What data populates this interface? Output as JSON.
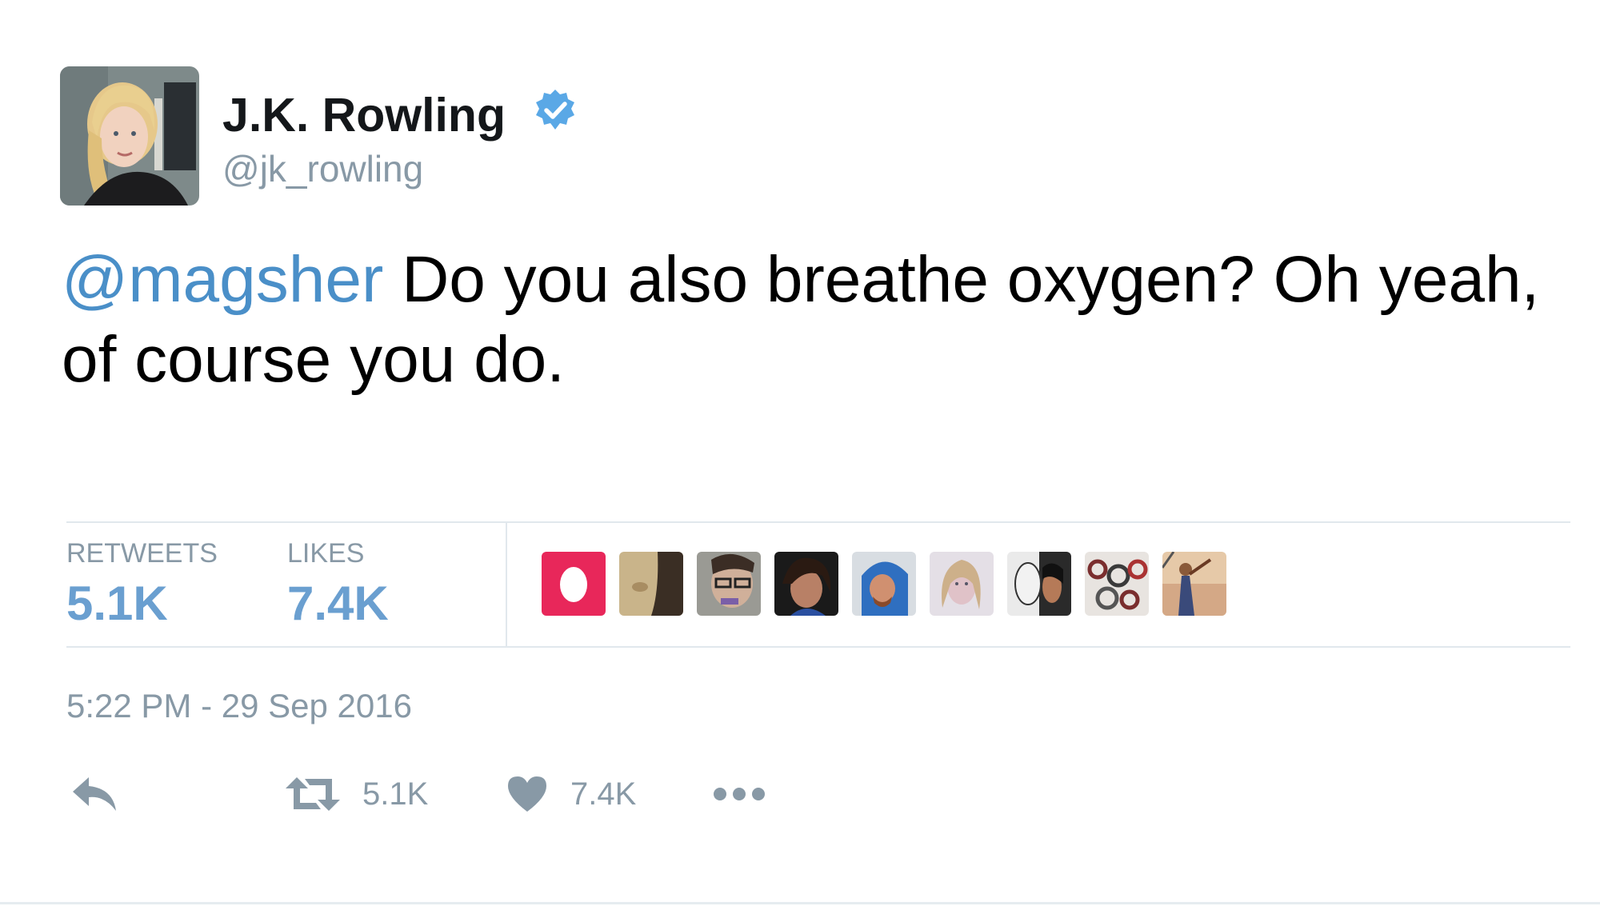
{
  "author": {
    "display_name": "J.K. Rowling",
    "handle": "@jk_rowling",
    "verified_icon": "verified-badge-icon",
    "avatar_icon": "profile-photo"
  },
  "tweet": {
    "mention": "@magsher",
    "text": " Do you also breathe oxygen? Oh yeah, of course you do."
  },
  "stats": {
    "retweets_label": "RETWEETS",
    "retweets_value": "5.1K",
    "likes_label": "LIKES",
    "likes_value": "7.4K"
  },
  "likers": [
    {
      "name": "liker-avatar-1"
    },
    {
      "name": "liker-avatar-2"
    },
    {
      "name": "liker-avatar-3"
    },
    {
      "name": "liker-avatar-4"
    },
    {
      "name": "liker-avatar-5"
    },
    {
      "name": "liker-avatar-6"
    },
    {
      "name": "liker-avatar-7"
    },
    {
      "name": "liker-avatar-8"
    },
    {
      "name": "liker-avatar-9"
    }
  ],
  "timestamp": "5:22 PM - 29 Sep 2016",
  "actions": {
    "reply_icon": "reply-icon",
    "retweet_icon": "retweet-icon",
    "retweet_count": "5.1K",
    "like_icon": "heart-icon",
    "like_count": "7.4K",
    "more_icon": "more-dots-icon"
  },
  "colors": {
    "mention": "#4a8fc8",
    "stat_value": "#6a9fd0",
    "muted": "#8899a6",
    "verified": "#5aa8e6",
    "divider": "#e1e8ed"
  }
}
